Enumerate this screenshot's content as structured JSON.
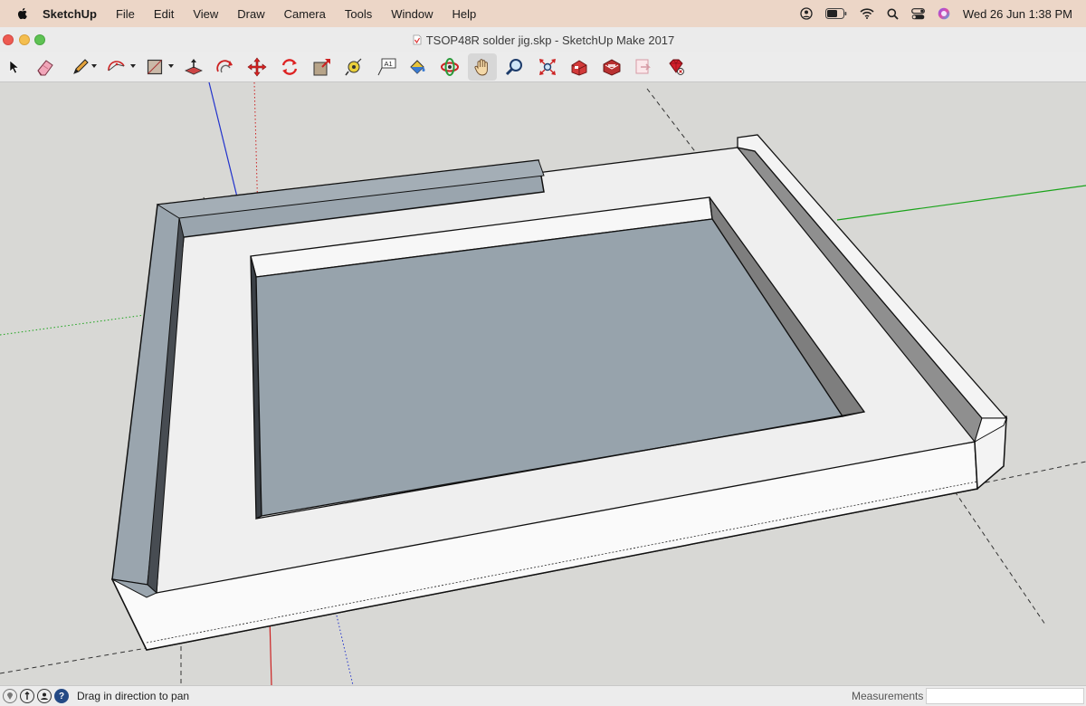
{
  "menubar": {
    "apple_icon": "apple-logo-icon",
    "app_name": "SketchUp",
    "items": [
      "File",
      "Edit",
      "View",
      "Draw",
      "Camera",
      "Tools",
      "Window",
      "Help"
    ],
    "status_icons": [
      "user-account-icon",
      "battery-icon",
      "wifi-icon",
      "spotlight-search-icon",
      "control-center-icon",
      "siri-icon"
    ],
    "clock": "Wed 26 Jun  1:38 PM",
    "background": "#ecd6c7"
  },
  "window": {
    "title": "TSOP48R solder jig.skp - SketchUp Make 2017",
    "buttons": [
      "close",
      "minimize",
      "maximize"
    ]
  },
  "toolbar": {
    "tools": [
      {
        "name": "select-tool",
        "icon": "arrow-cursor-icon"
      },
      {
        "name": "eraser-tool",
        "icon": "eraser-icon"
      },
      {
        "name": "line-tool",
        "icon": "pencil-icon",
        "dropdown": true
      },
      {
        "name": "arc-tool",
        "icon": "arc-icon",
        "dropdown": true
      },
      {
        "name": "shape-tool",
        "icon": "rectangle-icon",
        "dropdown": true
      },
      {
        "name": "push-pull-tool",
        "icon": "push-pull-icon"
      },
      {
        "name": "offset-tool",
        "icon": "offset-icon"
      },
      {
        "name": "move-tool",
        "icon": "move-arrows-icon"
      },
      {
        "name": "rotate-tool",
        "icon": "rotate-icon"
      },
      {
        "name": "scale-tool",
        "icon": "scale-icon"
      },
      {
        "name": "tape-measure-tool",
        "icon": "tape-measure-icon"
      },
      {
        "name": "text-tool",
        "icon": "text-label-icon",
        "label": "A1"
      },
      {
        "name": "paint-bucket-tool",
        "icon": "paint-bucket-icon"
      },
      {
        "name": "orbit-tool",
        "icon": "orbit-icon"
      },
      {
        "name": "pan-tool",
        "icon": "hand-pan-icon",
        "active": true
      },
      {
        "name": "zoom-tool",
        "icon": "magnifier-icon"
      },
      {
        "name": "zoom-extents-tool",
        "icon": "zoom-extents-icon"
      },
      {
        "name": "3d-warehouse-tool",
        "icon": "warehouse-icon"
      },
      {
        "name": "extension-warehouse-tool",
        "icon": "extension-warehouse-icon"
      },
      {
        "name": "layout-send-tool",
        "icon": "layout-send-icon"
      },
      {
        "name": "extension-manager-tool",
        "icon": "ruby-gem-icon"
      }
    ]
  },
  "model": {
    "description_colors": {
      "top_face": "#efefef",
      "inner_recess": "#97a3ac",
      "back_wall": "#9aa5ae",
      "wall_top": "#f3f3f3",
      "side_face": "#fafafa",
      "shadow_face": "#8f8f8f",
      "axis_red": "#cc2222",
      "axis_green": "#1aa31a",
      "axis_blue": "#2233cc"
    }
  },
  "statusbar": {
    "icons": [
      "geo-location-icon",
      "credits-icon",
      "user-icon",
      "help-icon"
    ],
    "help_glyph": "?",
    "text": "Drag in direction to pan",
    "measurements_label": "Measurements",
    "measurements_value": ""
  }
}
